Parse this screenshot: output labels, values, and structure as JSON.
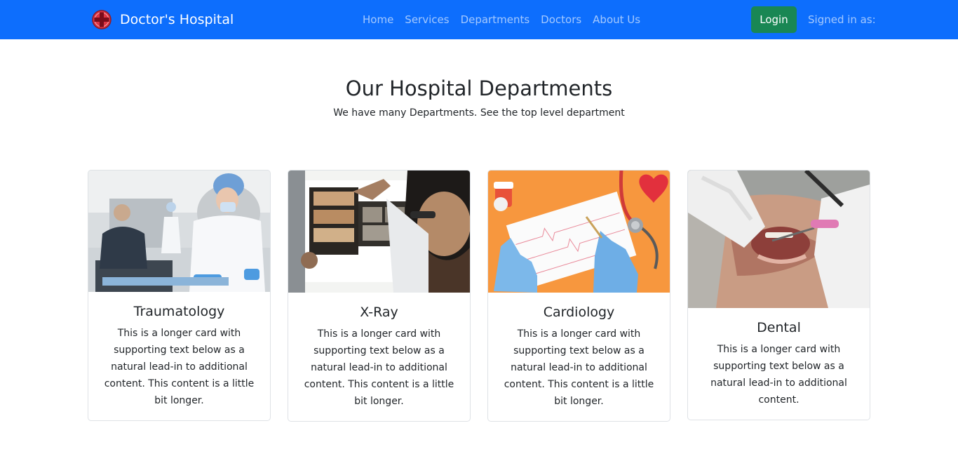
{
  "brand": {
    "name": "Doctor's Hospital",
    "logo_icon": "medical-cross-icon",
    "logo_color": "#dc3545"
  },
  "nav": {
    "links": [
      "Home",
      "Services",
      "Departments",
      "Doctors",
      "About Us"
    ],
    "login_label": "Login",
    "signed_in_label": "Signed in as:"
  },
  "colors": {
    "navbar": "#0d6efd",
    "login_button": "#198754"
  },
  "hero": {
    "title": "Our Hospital Departments",
    "subtitle": "We have many Departments. See the top level department"
  },
  "departments": [
    {
      "title": "Traumatology",
      "image": "lab-workers-photo",
      "text": "This is a longer card with supporting text below as a natural lead-in to additional content. This content is a little bit longer."
    },
    {
      "title": "X-Ray",
      "image": "doctor-xray-photo",
      "text": "This is a longer card with supporting text below as a natural lead-in to additional content. This content is a little bit longer."
    },
    {
      "title": "Cardiology",
      "image": "ecg-stethoscope-photo",
      "text": "This is a longer card with supporting text below as a natural lead-in to additional content. This content is a little bit longer."
    },
    {
      "title": "Dental",
      "image": "dental-exam-photo",
      "text": "This is a longer card with supporting text below as a natural lead-in to additional content."
    }
  ]
}
